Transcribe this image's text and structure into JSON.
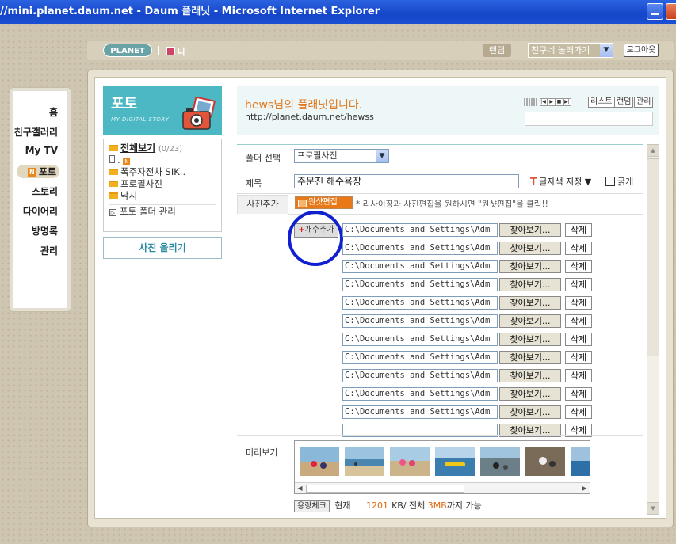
{
  "window": {
    "title": "//mini.planet.daum.net - Daum 플래닛 - Microsoft Internet Explorer"
  },
  "topbar": {
    "logo": "PLANET",
    "me": "나",
    "random": "랜덤",
    "friend_select": "친구네 놀러가기",
    "logout": "로그아웃"
  },
  "leftnav": {
    "items": [
      "홈",
      "친구갤러리",
      "My TV",
      "포토",
      "스토리",
      "다이어리",
      "방명록",
      "관리"
    ],
    "active_index": 3
  },
  "photo_header": {
    "title": "포토",
    "subtitle": "MY DIGITAL STORY"
  },
  "folders": {
    "all_label": "전체보기",
    "all_count": "(0/23)",
    "items": [
      {
        "label": "."
      },
      {
        "label": "폭주자전차 SIK.."
      },
      {
        "label": "프로필사진"
      },
      {
        "label": "낚시"
      }
    ],
    "manage_label": "포토 폴더 관리"
  },
  "upload_button": "사진 올리기",
  "welcome": {
    "title": "hews님의 플래닛입니다.",
    "url": "http://planet.daum.net/hewss"
  },
  "player": {
    "list": "리스트",
    "random": "랜덤",
    "manage": "관리"
  },
  "form": {
    "folder_label": "폴더 선택",
    "folder_value": "프로필사진",
    "title_label": "제목",
    "title_value": "주문진 해수욕장",
    "color_label": "글자색 지정 ▼",
    "color_icon": "T",
    "bold_label": "굵게",
    "add_photo_tab": "사진추가",
    "onesot_button": "원샷편집",
    "hint": "* 리사이징과 사진편집을 원하시면 \"원샷편집\"을 클릭!!",
    "add_count_button": "개수추가",
    "file_rows": [
      {
        "path": "C:\\Documents and Settings\\Adm"
      },
      {
        "path": "C:\\Documents and Settings\\Adm"
      },
      {
        "path": "C:\\Documents and Settings\\Adm"
      },
      {
        "path": "C:\\Documents and Settings\\Adm"
      },
      {
        "path": "C:\\Documents and Settings\\Adm"
      },
      {
        "path": "C:\\Documents and Settings\\Adm"
      },
      {
        "path": "C:\\Documents and Settings\\Adm"
      },
      {
        "path": "C:\\Documents and Settings\\Adm"
      },
      {
        "path": "C:\\Documents and Settings\\Adm"
      },
      {
        "path": "C:\\Documents and Settings\\Adm"
      },
      {
        "path": "C:\\Documents and Settings\\Adm"
      },
      {
        "path": ""
      }
    ],
    "browse_label": "찾아보기...",
    "delete_label": "삭제",
    "preview_label": "미리보기",
    "capacity_button": "용량체크",
    "capacity_current_label": "현재",
    "capacity_current": "1201",
    "capacity_unit": "KB/ 전체",
    "capacity_total": "3MB",
    "capacity_suffix": "까지 가능"
  },
  "colors": {
    "accent_teal": "#4cb8c4",
    "accent_orange": "#e07a20",
    "highlight_circle": "#1020d0"
  }
}
